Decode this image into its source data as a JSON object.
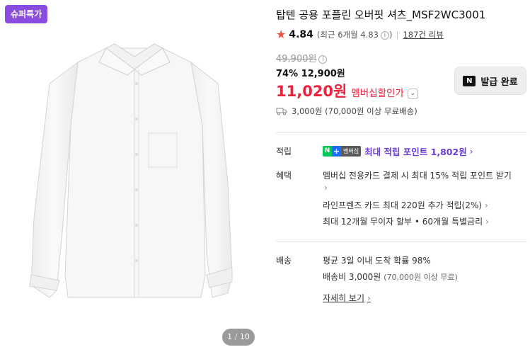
{
  "badge": "슈퍼특가",
  "pager": {
    "current": "1",
    "separator": "/",
    "total": "10"
  },
  "product": {
    "title": "탑텐 공용 포플린 오버핏 셔츠_MSF2WC3001"
  },
  "rating": {
    "score": "4.84",
    "recent": "(최근 6개월 4.83",
    "recent_close": ")",
    "reviews": "187건 리뷰"
  },
  "price": {
    "original": "49,900원",
    "discount_sale": "74% 12,900원",
    "member_price": "11,020원",
    "member_label": "멤버십할인가"
  },
  "coupon": {
    "logo": "N",
    "label": "발급 완료"
  },
  "shipping": {
    "text": "3,000원 (70,000원 이상 무료배송)"
  },
  "points": {
    "label": "적립",
    "badge_n": "N",
    "badge_plus": "+",
    "badge_text": "멤버십",
    "text": "최대 적립 포인트 1,802원"
  },
  "benefits": {
    "label": "혜택",
    "item1_line1": "멤버십 전용카드 결제 시 최대 15% 적립 포인트 받기",
    "item2": "라인프렌즈 카드 최대 220원 추가 적립(2%)",
    "item3": "최대 12개월 무이자 할부 • 60개월 특별금리"
  },
  "delivery": {
    "label": "배송",
    "line1": "평균 3일 이내 도착 확률 98%",
    "fee": "배송비 3,000원",
    "fee_note": "(70,000원 이상 무료)",
    "detail_link": "자세히 보기"
  },
  "colors": {
    "badge": "#8a4bdf",
    "discount_red": "#f0213a",
    "star": "#f24e3a",
    "points_purple": "#6a3bd6"
  },
  "icons": [
    "star-icon",
    "info-icon",
    "chevron-down-icon",
    "truck-icon",
    "chevron-right-icon",
    "naver-n-icon"
  ]
}
